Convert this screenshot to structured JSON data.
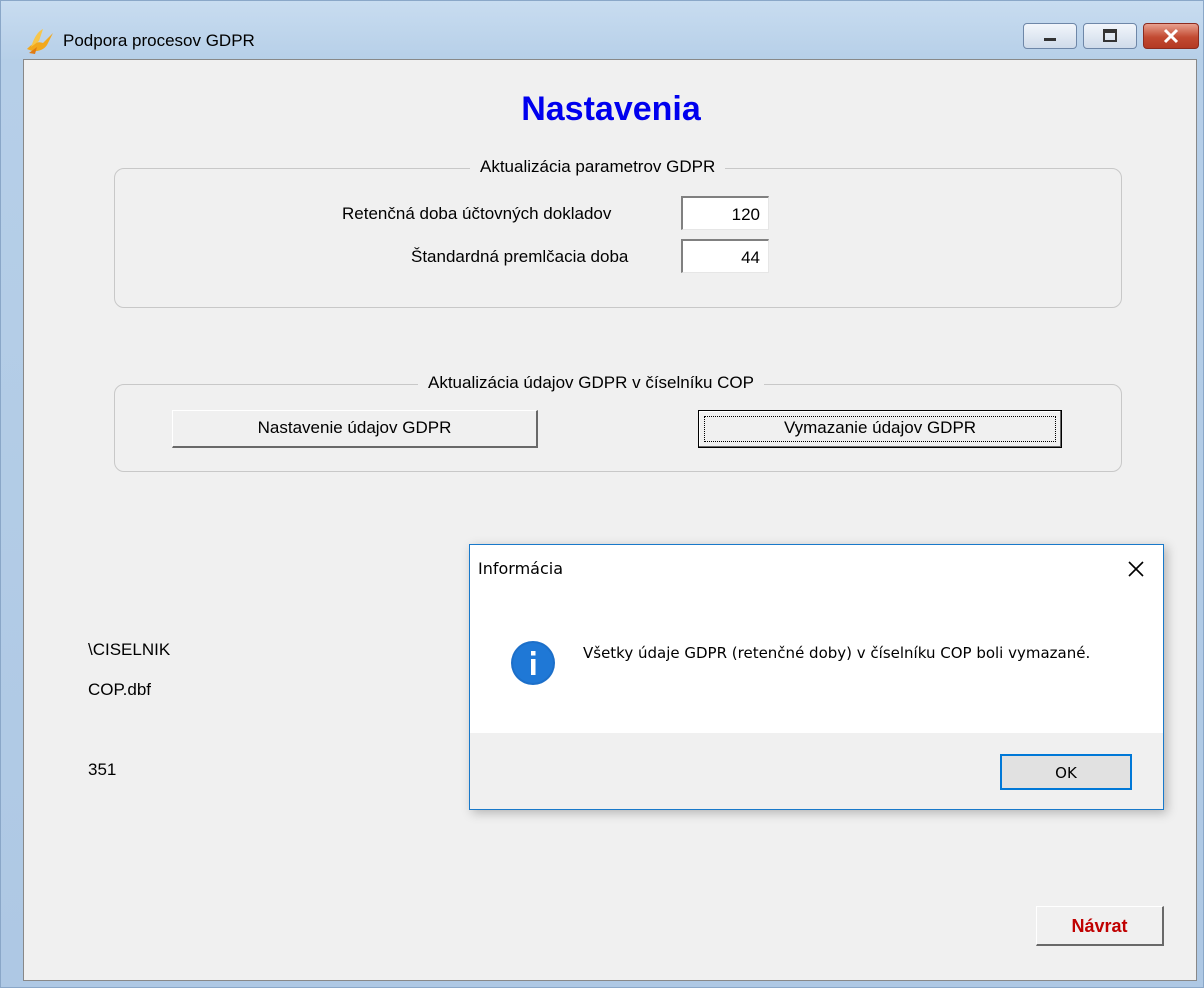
{
  "window": {
    "title": "Podpora procesov GDPR",
    "icon": "app-bird-icon"
  },
  "heading": "Nastavenia",
  "params_group": {
    "legend": "Aktualizácia parametrov GDPR",
    "retention_label": "Retenčná doba účtovných dokladov",
    "retention_value": "120",
    "prescription_label": "Štandardná premlčacia doba",
    "prescription_value": "44"
  },
  "cop_group": {
    "legend": "Aktualizácia údajov GDPR v číselníku COP",
    "set_button": "Nastavenie údajov GDPR",
    "delete_button": "Vymazanie údajov GDPR"
  },
  "info": {
    "path": "\\CISELNIK",
    "file": "COP.dbf",
    "count": "351"
  },
  "return_button": "Návrat",
  "dialog": {
    "title": "Informácia",
    "message": "Všetky údaje GDPR (retenčné doby) v číselníku COP boli vymazané.",
    "ok_button": "OK",
    "icon": "info-icon"
  },
  "colors": {
    "heading": "#0000ee",
    "return_text": "#c00000",
    "dialog_accent": "#0078d7"
  }
}
